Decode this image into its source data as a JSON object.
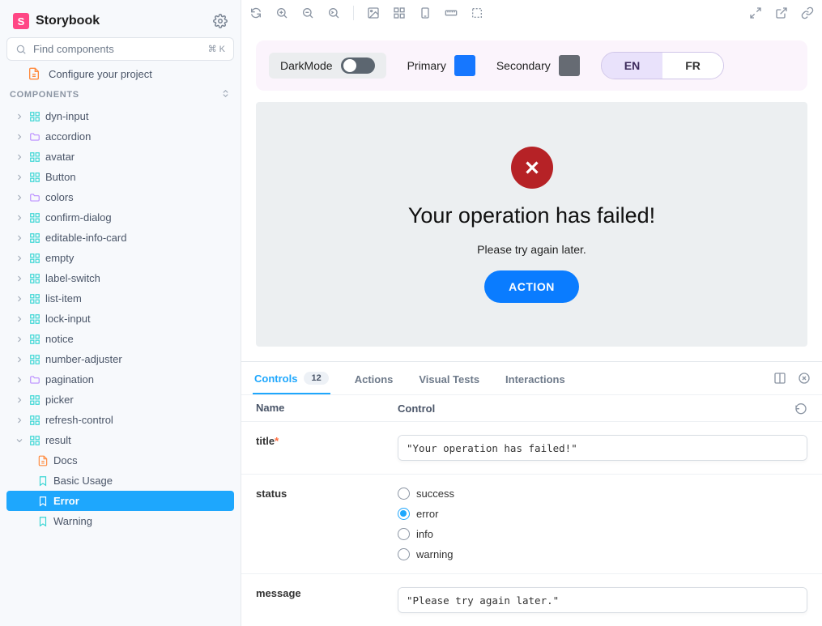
{
  "app": {
    "name": "Storybook"
  },
  "search": {
    "placeholder": "Find components",
    "shortcut": "⌘ K"
  },
  "config_link": "Configure your project",
  "section_label": "COMPONENTS",
  "tree": [
    {
      "label": "dyn-input",
      "icon": "grid",
      "open": false
    },
    {
      "label": "accordion",
      "icon": "folder",
      "open": false
    },
    {
      "label": "avatar",
      "icon": "grid",
      "open": false
    },
    {
      "label": "Button",
      "icon": "grid",
      "open": false
    },
    {
      "label": "colors",
      "icon": "folder",
      "open": false
    },
    {
      "label": "confirm-dialog",
      "icon": "grid",
      "open": false
    },
    {
      "label": "editable-info-card",
      "icon": "grid",
      "open": false
    },
    {
      "label": "empty",
      "icon": "grid",
      "open": false
    },
    {
      "label": "label-switch",
      "icon": "grid",
      "open": false
    },
    {
      "label": "list-item",
      "icon": "grid",
      "open": false
    },
    {
      "label": "lock-input",
      "icon": "grid",
      "open": false
    },
    {
      "label": "notice",
      "icon": "grid",
      "open": false
    },
    {
      "label": "number-adjuster",
      "icon": "grid",
      "open": false
    },
    {
      "label": "pagination",
      "icon": "folder",
      "open": false
    },
    {
      "label": "picker",
      "icon": "grid",
      "open": false
    },
    {
      "label": "refresh-control",
      "icon": "grid",
      "open": false
    },
    {
      "label": "result",
      "icon": "grid",
      "open": true,
      "children": [
        {
          "label": "Docs",
          "icon": "doc",
          "kind": "docs"
        },
        {
          "label": "Basic Usage",
          "icon": "story",
          "kind": "story"
        },
        {
          "label": "Error",
          "icon": "story",
          "kind": "story",
          "selected": true
        },
        {
          "label": "Warning",
          "icon": "story",
          "kind": "story"
        }
      ]
    }
  ],
  "globals": {
    "darkmode_label": "DarkMode",
    "primary_label": "Primary",
    "primary_color": "#1677ff",
    "secondary_label": "Secondary",
    "secondary_color": "#666b73",
    "lang": {
      "options": [
        "EN",
        "FR"
      ],
      "active": "EN"
    }
  },
  "preview": {
    "title": "Your operation has failed!",
    "message": "Please try again later.",
    "action_label": "ACTION"
  },
  "panel": {
    "tabs": [
      {
        "label": "Controls",
        "badge": "12",
        "active": true
      },
      {
        "label": "Actions"
      },
      {
        "label": "Visual Tests"
      },
      {
        "label": "Interactions"
      }
    ],
    "header": {
      "name_col": "Name",
      "control_col": "Control"
    },
    "rows": {
      "title": {
        "name": "title",
        "required": true,
        "value": "\"Your operation has failed!\""
      },
      "status": {
        "name": "status",
        "options": [
          "success",
          "error",
          "info",
          "warning"
        ],
        "value": "error"
      },
      "message": {
        "name": "message",
        "value": "\"Please try again later.\""
      }
    }
  }
}
